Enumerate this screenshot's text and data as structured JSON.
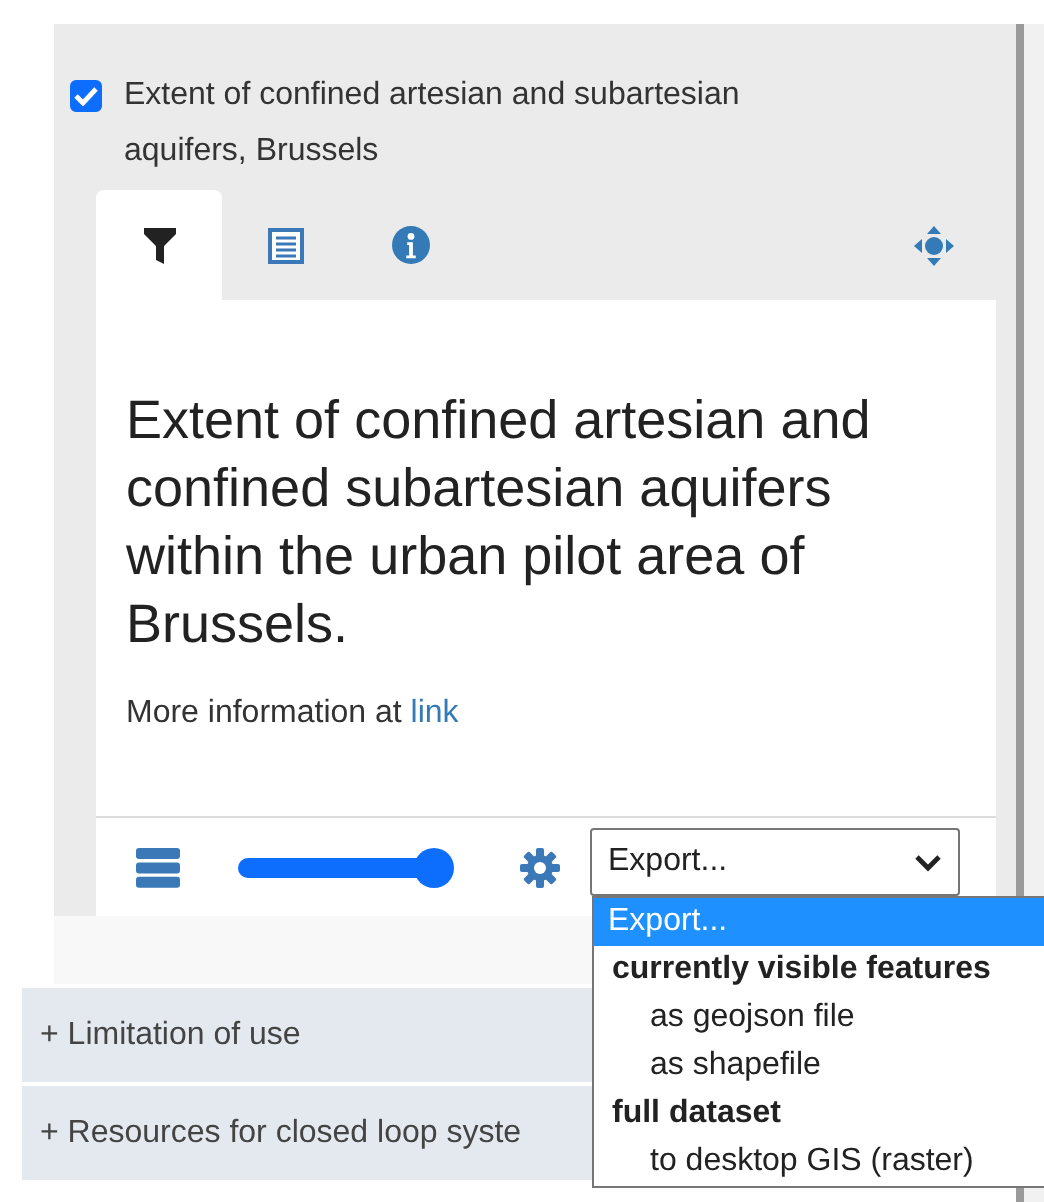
{
  "layer": {
    "title": "Extent of confined artesian and subartesian aquifers, Brussels",
    "checked": true
  },
  "tabs": [
    {
      "kind": "filter",
      "selected": true
    },
    {
      "kind": "table",
      "selected": false
    },
    {
      "kind": "info",
      "selected": false
    },
    {
      "kind": "zoom",
      "selected": false
    }
  ],
  "description": "Extent of confined artesian and confined subartesian aquifers within the urban pilot area of Brussels.",
  "more_info": {
    "text": "More information at",
    "link": "link"
  },
  "opacity_slider": {
    "level": 1.0
  },
  "export_select": {
    "value": "Export...",
    "expanded": true
  },
  "export_options": [
    {
      "kind": "option",
      "label": "Export...",
      "selected": true
    },
    {
      "kind": "group",
      "label": "currently visible features"
    },
    {
      "kind": "option",
      "label": "as geojson file",
      "selected": false
    },
    {
      "kind": "option",
      "label": "as shapefile",
      "selected": false
    },
    {
      "kind": "group",
      "label": "full dataset"
    },
    {
      "kind": "option",
      "label": "to desktop GIS (raster)",
      "selected": false
    }
  ],
  "sections": [
    {
      "label": "+ Limitation of use"
    },
    {
      "label": "+ Resources for closed loop syste"
    }
  ]
}
